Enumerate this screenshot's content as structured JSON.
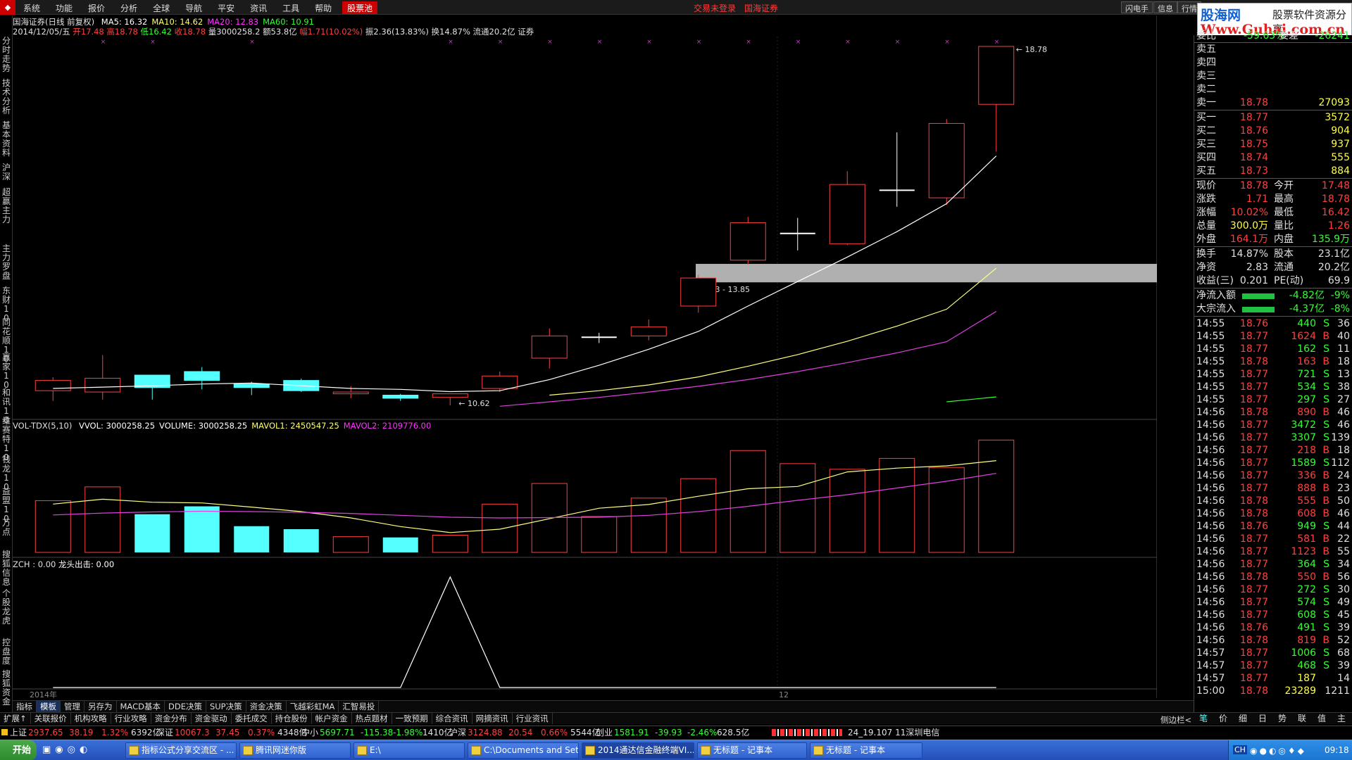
{
  "menu": {
    "items": [
      "系统",
      "功能",
      "报价",
      "分析",
      "全球",
      "导航",
      "平安",
      "资讯",
      "工具",
      "帮助",
      "股票池"
    ],
    "highlight": "股票池",
    "center_status": "交易未登录",
    "broker": "国海证券",
    "right_buttons": [
      "闪电手",
      "信息",
      "行情"
    ]
  },
  "watermark": {
    "brand": "股海网",
    "slogan": "股票软件资源分享",
    "url": "Www.Guhai.com.cn"
  },
  "left_tabs": [
    "分时走势",
    "技术分析",
    "基本资料",
    "沪深",
    "超赢主力",
    "主力罗盘",
    "东财10",
    "同花顺10",
    "赢家10",
    "和讯10",
    "维赛特10",
    "钱龙10",
    "益盟10",
    "万点",
    "搜狐信息",
    "个股龙虎",
    "控盘度",
    "搜狐资金"
  ],
  "info": {
    "title_line": "国海证券(日线 前复权)",
    "ma": [
      {
        "label": "MA5: 16.32",
        "color": "#ffffff"
      },
      {
        "label": "MA10: 14.62",
        "color": "#ffff66"
      },
      {
        "label": "MA20: 12.83",
        "color": "#ff33ff"
      },
      {
        "label": "MA60: 10.91",
        "color": "#33ff33"
      }
    ],
    "bar_line_date": "2014/12/05/五",
    "bar_line_open": "开17.48",
    "bar_line_high": "高18.78",
    "bar_line_low": "低16.42",
    "bar_line_close": "收18.78",
    "bar_line_vol": "量3000258.2",
    "bar_line_amount": "额53.8亿",
    "bar_line_range": "幅1.71(10.02%)",
    "bar_line_swing": "振2.36(13.83%)",
    "bar_line_turn": "换14.87%",
    "bar_line_float": "流通20.2亿",
    "bar_line_tag": "证券"
  },
  "chart_data": [
    {
      "type": "candlestick",
      "ylim": [
        10.5,
        19.0
      ],
      "y_ticks": [
        "19.00",
        "18.50",
        "18.00",
        "17.50",
        "17.00",
        "16.50",
        "16.00",
        "15.50",
        "15.00",
        "14.50",
        "14.00",
        "13.50",
        "13.00",
        "12.50",
        "12.00",
        "11.50",
        "11.00",
        "10.50"
      ],
      "candles": [
        {
          "o": 11.05,
          "h": 11.35,
          "l": 10.82,
          "c": 11.28
        },
        {
          "o": 11.02,
          "h": 11.85,
          "l": 10.85,
          "c": 11.33
        },
        {
          "o": 11.4,
          "h": 11.4,
          "l": 10.85,
          "c": 11.12
        },
        {
          "o": 11.48,
          "h": 11.58,
          "l": 11.08,
          "c": 11.28
        },
        {
          "o": 11.2,
          "h": 11.25,
          "l": 10.95,
          "c": 11.12
        },
        {
          "o": 11.28,
          "h": 11.32,
          "l": 11.02,
          "c": 11.05
        },
        {
          "o": 10.98,
          "h": 11.15,
          "l": 10.88,
          "c": 11.02
        },
        {
          "o": 10.95,
          "h": 10.98,
          "l": 10.82,
          "c": 10.88
        },
        {
          "o": 10.9,
          "h": 10.95,
          "l": 10.72,
          "c": 10.98
        },
        {
          "o": 11.1,
          "h": 11.48,
          "l": 11.02,
          "c": 11.38
        },
        {
          "o": 11.78,
          "h": 12.45,
          "l": 11.55,
          "c": 12.28
        },
        {
          "o": 12.25,
          "h": 12.35,
          "l": 12.12,
          "c": 12.25
        },
        {
          "o": 12.28,
          "h": 12.65,
          "l": 12.18,
          "c": 12.48
        },
        {
          "o": 12.95,
          "h": 13.65,
          "l": 12.8,
          "c": 13.58
        },
        {
          "o": 13.98,
          "h": 14.95,
          "l": 13.88,
          "c": 14.82
        },
        {
          "o": 14.58,
          "h": 14.93,
          "l": 14.2,
          "c": 14.58
        },
        {
          "o": 14.35,
          "h": 15.98,
          "l": 14.32,
          "c": 15.68
        },
        {
          "o": 15.55,
          "h": 16.85,
          "l": 15.18,
          "c": 15.55
        },
        {
          "o": 15.38,
          "h": 17.15,
          "l": 15.22,
          "c": 17.05
        },
        {
          "o": 17.48,
          "h": 18.78,
          "l": 16.42,
          "c": 18.78
        }
      ],
      "ma5": [
        11.1,
        11.13,
        11.16,
        11.2,
        11.22,
        11.16,
        11.1,
        11.08,
        11.03,
        11.05,
        11.3,
        11.62,
        11.98,
        12.38,
        12.95,
        13.5,
        14.05,
        14.62,
        15.25,
        16.32
      ],
      "ma10": [
        null,
        null,
        null,
        null,
        null,
        null,
        null,
        null,
        null,
        null,
        10.95,
        11.05,
        11.18,
        11.36,
        11.6,
        11.86,
        12.16,
        12.5,
        12.88,
        13.8
      ],
      "ma20": [
        null,
        null,
        null,
        null,
        null,
        null,
        null,
        null,
        null,
        10.7,
        10.8,
        10.9,
        11.02,
        11.15,
        11.3,
        11.48,
        11.68,
        11.9,
        12.15,
        12.83
      ],
      "ma60": [
        null,
        null,
        null,
        null,
        null,
        null,
        null,
        null,
        null,
        null,
        null,
        null,
        null,
        null,
        null,
        null,
        null,
        null,
        10.8,
        10.91
      ],
      "high_label": "18.78",
      "low_label": "10.62",
      "band_label": "13.53 - 13.85",
      "band_range": [
        13.53,
        13.85
      ],
      "x_labels": [
        "2014年",
        "12"
      ],
      "x_period": "日线"
    },
    {
      "type": "bar",
      "title": "VOL-TDX(5,10)",
      "legend": [
        {
          "label": "VVOL: 3000258.25",
          "color": "#ffffff"
        },
        {
          "label": "VOLUME: 3000258.25",
          "color": "#ffffff"
        },
        {
          "label": "MAVOL1: 2450547.25",
          "color": "#ffff66"
        },
        {
          "label": "MAVOL2: 2109776.00",
          "color": "#ff33ff"
        }
      ],
      "ylim": [
        0,
        3100000
      ],
      "y_ticks": [
        "30000",
        "25000",
        "20000",
        "15000",
        "10000",
        "5000"
      ],
      "unit": "X100",
      "values": [
        1380000,
        1750000,
        1020000,
        1230000,
        700000,
        620000,
        420000,
        400000,
        460000,
        1290000,
        1840000,
        960000,
        1450000,
        1970000,
        2720000,
        2370000,
        2220000,
        2510000,
        2270000,
        3000000
      ],
      "mavol1": [
        1290000,
        1420000,
        1340000,
        1320000,
        1210000,
        1090000,
        920000,
        690000,
        530000,
        620000,
        900000,
        1180000,
        1280000,
        1500000,
        1700000,
        1760000,
        2150000,
        2250000,
        2310000,
        2450000
      ],
      "mavol2": [
        1000000,
        1050000,
        1080000,
        1100000,
        1090000,
        1070000,
        1040000,
        990000,
        940000,
        920000,
        930000,
        940000,
        990000,
        1090000,
        1230000,
        1390000,
        1540000,
        1720000,
        1900000,
        2110000
      ]
    },
    {
      "type": "line",
      "title": "ZCH : 0.00",
      "legend_extra": "龙头出击: 0.00",
      "ylim": [
        0,
        1.05
      ],
      "y_ticks": [
        "1.00",
        "0.80",
        "0.60",
        "0.40",
        "0.20"
      ],
      "values": [
        0,
        0,
        0,
        0,
        0,
        0,
        0,
        0,
        1.0,
        0,
        0,
        0,
        0,
        0,
        0,
        0,
        0,
        0,
        0,
        0
      ]
    }
  ],
  "quote": {
    "top_labels": [
      "委比",
      "委差"
    ],
    "top_values": [
      "-59.63%",
      "-26241"
    ],
    "sell": [
      {
        "label": "卖五",
        "price": "",
        "vol": ""
      },
      {
        "label": "卖四",
        "price": "",
        "vol": ""
      },
      {
        "label": "卖三",
        "price": "",
        "vol": ""
      },
      {
        "label": "卖二",
        "price": "",
        "vol": ""
      },
      {
        "label": "卖一",
        "price": "18.78",
        "vol": "27093"
      }
    ],
    "buy": [
      {
        "label": "买一",
        "price": "18.77",
        "vol": "3572"
      },
      {
        "label": "买二",
        "price": "18.76",
        "vol": "904"
      },
      {
        "label": "买三",
        "price": "18.75",
        "vol": "937"
      },
      {
        "label": "买四",
        "price": "18.74",
        "vol": "555"
      },
      {
        "label": "买五",
        "price": "18.73",
        "vol": "884"
      }
    ],
    "stats": [
      {
        "l1": "现价",
        "v1": "18.78",
        "c1": "#ff4040",
        "l2": "今开",
        "v2": "17.48",
        "c2": "#ff4040"
      },
      {
        "l1": "涨跌",
        "v1": "1.71",
        "c1": "#ff4040",
        "l2": "最高",
        "v2": "18.78",
        "c2": "#ff4040"
      },
      {
        "l1": "涨幅",
        "v1": "10.02%",
        "c1": "#ff4040",
        "l2": "最低",
        "v2": "16.42",
        "c2": "#ff4040"
      },
      {
        "l1": "总量",
        "v1": "300.0万",
        "c1": "#ffff40",
        "l2": "量比",
        "v2": "1.26",
        "c2": "#ff4040"
      },
      {
        "l1": "外盘",
        "v1": "164.1万",
        "c1": "#ff4040",
        "l2": "内盘",
        "v2": "135.9万",
        "c2": "#33ff33"
      },
      {
        "l1": "换手",
        "v1": "14.87%",
        "c1": "#e0e0e0",
        "l2": "股本",
        "v2": "23.1亿",
        "c2": "#e0e0e0"
      },
      {
        "l1": "净资",
        "v1": "2.83",
        "c1": "#e0e0e0",
        "l2": "流通",
        "v2": "20.2亿",
        "c2": "#e0e0e0"
      },
      {
        "l1": "收益(三)",
        "v1": "0.201",
        "c1": "#e0e0e0",
        "l2": "PE(动)",
        "v2": "69.9",
        "c2": "#e0e0e0"
      }
    ],
    "flows": [
      {
        "label": "净流入额",
        "value": "-4.82亿",
        "pct": "-9%"
      },
      {
        "label": "大宗流入",
        "value": "-4.37亿",
        "pct": "-8%"
      }
    ],
    "ticks": [
      [
        "14:55",
        "18.76",
        "440",
        "S",
        "36"
      ],
      [
        "14:55",
        "18.77",
        "1624",
        "B",
        "40"
      ],
      [
        "14:55",
        "18.77",
        "162",
        "S",
        "11"
      ],
      [
        "14:55",
        "18.78",
        "163",
        "B",
        "18"
      ],
      [
        "14:55",
        "18.77",
        "721",
        "S",
        "13"
      ],
      [
        "14:55",
        "18.77",
        "534",
        "S",
        "38"
      ],
      [
        "14:55",
        "18.77",
        "297",
        "S",
        "27"
      ],
      [
        "14:56",
        "18.78",
        "890",
        "B",
        "46"
      ],
      [
        "14:56",
        "18.77",
        "3472",
        "S",
        "46"
      ],
      [
        "14:56",
        "18.77",
        "3307",
        "S",
        "139"
      ],
      [
        "14:56",
        "18.77",
        "218",
        "B",
        "18"
      ],
      [
        "14:56",
        "18.77",
        "1589",
        "S",
        "112"
      ],
      [
        "14:56",
        "18.77",
        "336",
        "B",
        "24"
      ],
      [
        "14:56",
        "18.77",
        "888",
        "B",
        "23"
      ],
      [
        "14:56",
        "18.78",
        "555",
        "B",
        "50"
      ],
      [
        "14:56",
        "18.78",
        "608",
        "B",
        "46"
      ],
      [
        "14:56",
        "18.76",
        "949",
        "S",
        "44"
      ],
      [
        "14:56",
        "18.77",
        "581",
        "B",
        "22"
      ],
      [
        "14:56",
        "18.77",
        "1123",
        "B",
        "55"
      ],
      [
        "14:56",
        "18.77",
        "364",
        "S",
        "34"
      ],
      [
        "14:56",
        "18.78",
        "550",
        "B",
        "56"
      ],
      [
        "14:56",
        "18.77",
        "272",
        "S",
        "30"
      ],
      [
        "14:56",
        "18.77",
        "574",
        "S",
        "49"
      ],
      [
        "14:56",
        "18.77",
        "608",
        "S",
        "45"
      ],
      [
        "14:56",
        "18.76",
        "491",
        "S",
        "39"
      ],
      [
        "14:56",
        "18.78",
        "819",
        "B",
        "52"
      ],
      [
        "14:57",
        "18.77",
        "1006",
        "S",
        "68"
      ],
      [
        "14:57",
        "18.77",
        "468",
        "S",
        "39"
      ],
      [
        "14:57",
        "18.77",
        "187",
        "",
        "14"
      ],
      [
        "15:00",
        "18.78",
        "23289",
        "",
        "1211"
      ]
    ],
    "bottom_tabs": [
      "笔",
      "价",
      "细",
      "日",
      "势",
      "联",
      "值",
      "主"
    ]
  },
  "tabs_row1": [
    "指标",
    "模板",
    "管理",
    "另存为",
    "MACD基本",
    "DDE决策",
    "SUP决策",
    "资金决策",
    "飞越彩虹MA",
    "汇智易投"
  ],
  "tabs_row1_active": "模板",
  "tabs_row2": [
    "扩展↑",
    "关联报价",
    "机构攻略",
    "行业攻略",
    "资金分布",
    "资金驱动",
    "委托成交",
    "持仓股份",
    "帐户资金",
    "热点题材",
    "一致预期",
    "综合资讯",
    "网摘资讯",
    "行业资讯"
  ],
  "side_toggle": "侧边栏<",
  "status": {
    "sh_label": "上证",
    "sh_val": "2937.65",
    "sh_chg": "38.19",
    "sh_pct": "1.32%",
    "sh_amt": "6392亿",
    "sz_label": "深证",
    "sz_val": "10067.3",
    "sz_chg": "37.45",
    "sz_pct": "0.37%",
    "sz_amt": "4348亿",
    "zx_label": "中小",
    "zx_val": "5697.71",
    "zx_chg": "-115.38",
    "zx_pct": "-1.98%",
    "zx_amt": "1410亿",
    "hs_label": "沪深",
    "hs_val": "3124.88",
    "hs_chg": "20.54",
    "hs_pct": "0.66%",
    "hs_amt": "5544亿",
    "cy_label": "创业",
    "cy_val": "1581.91",
    "cy_chg": "-39.93",
    "cy_pct": "-2.46%",
    "cy_amt": "628.5亿",
    "server": "24_19.107 11深圳电信"
  },
  "taskbar": {
    "start": "开始",
    "tasks": [
      {
        "label": "指标公式分享交流区 - ...",
        "active": false
      },
      {
        "label": "腾讯网迷你版",
        "active": false
      },
      {
        "label": "E:\\",
        "active": false
      },
      {
        "label": "C:\\Documents and Settin...",
        "active": false
      },
      {
        "label": "2014通达信金融终端VI...",
        "active": true
      },
      {
        "label": "无标题 - 记事本",
        "active": false
      },
      {
        "label": "无标题 - 记事本",
        "active": false
      }
    ],
    "ime": "CH",
    "clock": "09:18"
  }
}
